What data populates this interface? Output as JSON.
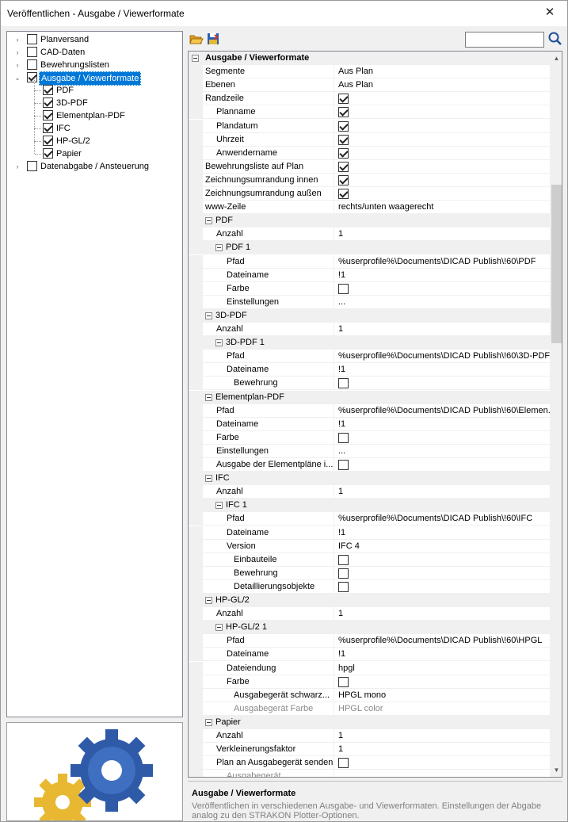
{
  "window": {
    "title": "Veröffentlichen - Ausgabe / Viewerformate",
    "close_glyph": "✕"
  },
  "tree": {
    "items": [
      {
        "label": "Planversand",
        "checked": false,
        "expander": "›"
      },
      {
        "label": "CAD-Daten",
        "checked": false,
        "expander": "›"
      },
      {
        "label": "Bewehrungslisten",
        "checked": false,
        "expander": "›"
      },
      {
        "label": "Ausgabe / Viewerformate",
        "checked": true,
        "expander": "⌄",
        "selected": true
      },
      {
        "label": "PDF",
        "checked": true
      },
      {
        "label": "3D-PDF",
        "checked": true
      },
      {
        "label": "Elementplan-PDF",
        "checked": true
      },
      {
        "label": "IFC",
        "checked": true
      },
      {
        "label": "HP-GL/2",
        "checked": true
      },
      {
        "label": "Papier",
        "checked": true
      },
      {
        "label": "Datenabgabe / Ansteuerung",
        "checked": false,
        "expander": "›"
      }
    ]
  },
  "toolbar": {
    "open_icon": "folder-open-icon",
    "save_icon": "save-icon",
    "search_value": "",
    "search_icon": "search-icon"
  },
  "grid": {
    "rows": [
      {
        "kind": "cat",
        "name": "Ausgabe / Viewerformate",
        "level": 0
      },
      {
        "name": "Segmente",
        "level": 0,
        "value": "Aus Plan"
      },
      {
        "name": "Ebenen",
        "level": 0,
        "value": "Aus Plan"
      },
      {
        "name": "Randzeile",
        "level": 0,
        "check": true
      },
      {
        "name": "Planname",
        "level": 1,
        "check": true
      },
      {
        "name": "Plandatum",
        "level": 1,
        "check": true
      },
      {
        "name": "Uhrzeit",
        "level": 1,
        "check": true
      },
      {
        "name": "Anwendername",
        "level": 1,
        "check": true
      },
      {
        "name": "Bewehrungsliste auf Plan",
        "level": 0,
        "check": true
      },
      {
        "name": "Zeichnungsumrandung innen",
        "level": 0,
        "check": true
      },
      {
        "name": "Zeichnungsumrandung außen",
        "level": 0,
        "check": true
      },
      {
        "name": "www-Zeile",
        "level": 0,
        "value": "rechts/unten waagerecht"
      },
      {
        "kind": "sub",
        "name": "PDF",
        "level": 1
      },
      {
        "name": "Anzahl",
        "level": 1,
        "value": "1"
      },
      {
        "kind": "sub",
        "name": "PDF 1",
        "level": 2
      },
      {
        "name": "Pfad",
        "level": 2,
        "value": "%userprofile%\\Documents\\DICAD Publish\\!60\\PDF"
      },
      {
        "name": "Dateiname",
        "level": 2,
        "value": "!1"
      },
      {
        "name": "Farbe",
        "level": 2,
        "check": false
      },
      {
        "name": "Einstellungen",
        "level": 2,
        "value": "..."
      },
      {
        "kind": "sub",
        "name": "3D-PDF",
        "level": 1
      },
      {
        "name": "Anzahl",
        "level": 1,
        "value": "1"
      },
      {
        "kind": "sub",
        "name": "3D-PDF 1",
        "level": 2
      },
      {
        "name": "Pfad",
        "level": 2,
        "value": "%userprofile%\\Documents\\DICAD Publish\\!60\\3D-PDF"
      },
      {
        "name": "Dateiname",
        "level": 2,
        "value": "!1"
      },
      {
        "name": "Bewehrung",
        "level": 3,
        "check": false
      },
      {
        "kind": "sub",
        "name": "Elementplan-PDF",
        "level": 1
      },
      {
        "name": "Pfad",
        "level": 1,
        "value": "%userprofile%\\Documents\\DICAD Publish\\!60\\Elemen..."
      },
      {
        "name": "Dateiname",
        "level": 1,
        "value": "!1"
      },
      {
        "name": "Farbe",
        "level": 1,
        "check": false
      },
      {
        "name": "Einstellungen",
        "level": 1,
        "value": "..."
      },
      {
        "name": "Ausgabe der Elementpläne i...",
        "level": 1,
        "check": false
      },
      {
        "kind": "sub",
        "name": "IFC",
        "level": 1
      },
      {
        "name": "Anzahl",
        "level": 1,
        "value": "1"
      },
      {
        "kind": "sub",
        "name": "IFC 1",
        "level": 2
      },
      {
        "name": "Pfad",
        "level": 2,
        "value": "%userprofile%\\Documents\\DICAD Publish\\!60\\IFC"
      },
      {
        "name": "Dateiname",
        "level": 2,
        "value": "!1"
      },
      {
        "name": "Version",
        "level": 2,
        "value": "IFC 4"
      },
      {
        "name": "Einbauteile",
        "level": 3,
        "check": false
      },
      {
        "name": "Bewehrung",
        "level": 3,
        "check": false
      },
      {
        "name": "Detaillierungsobjekte",
        "level": 3,
        "check": false
      },
      {
        "kind": "sub",
        "name": "HP-GL/2",
        "level": 1
      },
      {
        "name": "Anzahl",
        "level": 1,
        "value": "1"
      },
      {
        "kind": "sub",
        "name": "HP-GL/2 1",
        "level": 2
      },
      {
        "name": "Pfad",
        "level": 2,
        "value": "%userprofile%\\Documents\\DICAD Publish\\!60\\HPGL"
      },
      {
        "name": "Dateiname",
        "level": 2,
        "value": "!1"
      },
      {
        "name": "Dateiendung",
        "level": 2,
        "value": "hpgl"
      },
      {
        "name": "Farbe",
        "level": 2,
        "check": false
      },
      {
        "name": "Ausgabegerät schwarz...",
        "level": 3,
        "value": "HPGL mono"
      },
      {
        "name": "Ausgabegerät Farbe",
        "level": 3,
        "value": "HPGL color",
        "disabled": true
      },
      {
        "kind": "sub",
        "name": "Papier",
        "level": 1
      },
      {
        "name": "Anzahl",
        "level": 1,
        "value": "1"
      },
      {
        "name": "Verkleinerungsfaktor",
        "level": 1,
        "value": "1"
      },
      {
        "name": "Plan an Ausgabegerät senden",
        "level": 1,
        "check": false
      },
      {
        "name": "Ausgabegerät",
        "level": 2,
        "value": "",
        "disabled": true
      }
    ]
  },
  "description": {
    "title": "Ausgabe / Viewerformate",
    "text": "Veröffentlichen in verschiedenen Ausgabe- und Viewerformaten. Einstellungen der Abgabe analog zu den STRAKON Plotter-Optionen."
  },
  "colors": {
    "selection": "#0078d7",
    "gear_blue": "#2e5aa8",
    "gear_yellow": "#e8b832"
  }
}
